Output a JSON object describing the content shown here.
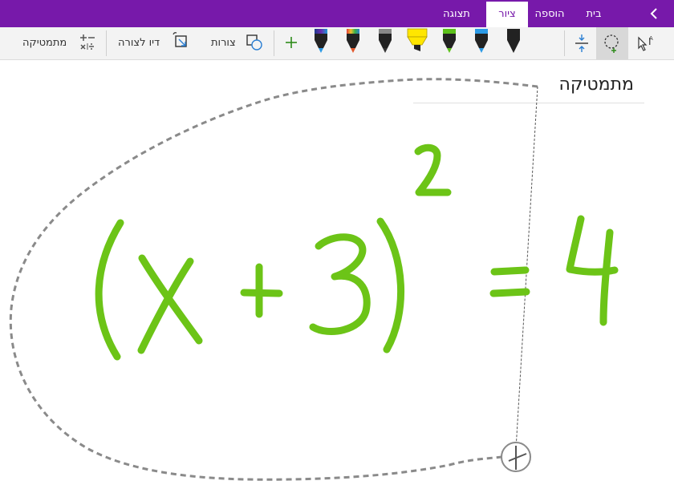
{
  "tabs": [
    {
      "label": "בית",
      "active": false
    },
    {
      "label": "הוספה",
      "active": false
    },
    {
      "label": "ציור",
      "active": true
    },
    {
      "label": "תצוגה",
      "active": false
    }
  ],
  "ribbon": {
    "math_label": "מתמטיקה",
    "ink_to_shape_label": "דיו לצורה",
    "shapes_label": "צורות",
    "tools": [
      "type-select-icon",
      "lasso-select-icon",
      "add-space-icon",
      "eraser-icon",
      "pen-black-icon",
      "pen-blue-icon",
      "pen-green-icon",
      "highlighter-yellow-icon",
      "pencil-gray-icon",
      "pen-galaxy-icon",
      "pen-rainbow-icon",
      "add-pen-icon"
    ],
    "pen_colors": {
      "black": "#222222",
      "blue": "#2b9ae6",
      "green": "#5cc11a",
      "yellow": "#ffe600",
      "eraser_pink": "#d36fd0",
      "eraser_orange": "#ff9c2a"
    }
  },
  "page": {
    "title": "מתמטיקה",
    "ink_color": "#6cc417",
    "equation": "(x+3)^2=4"
  }
}
